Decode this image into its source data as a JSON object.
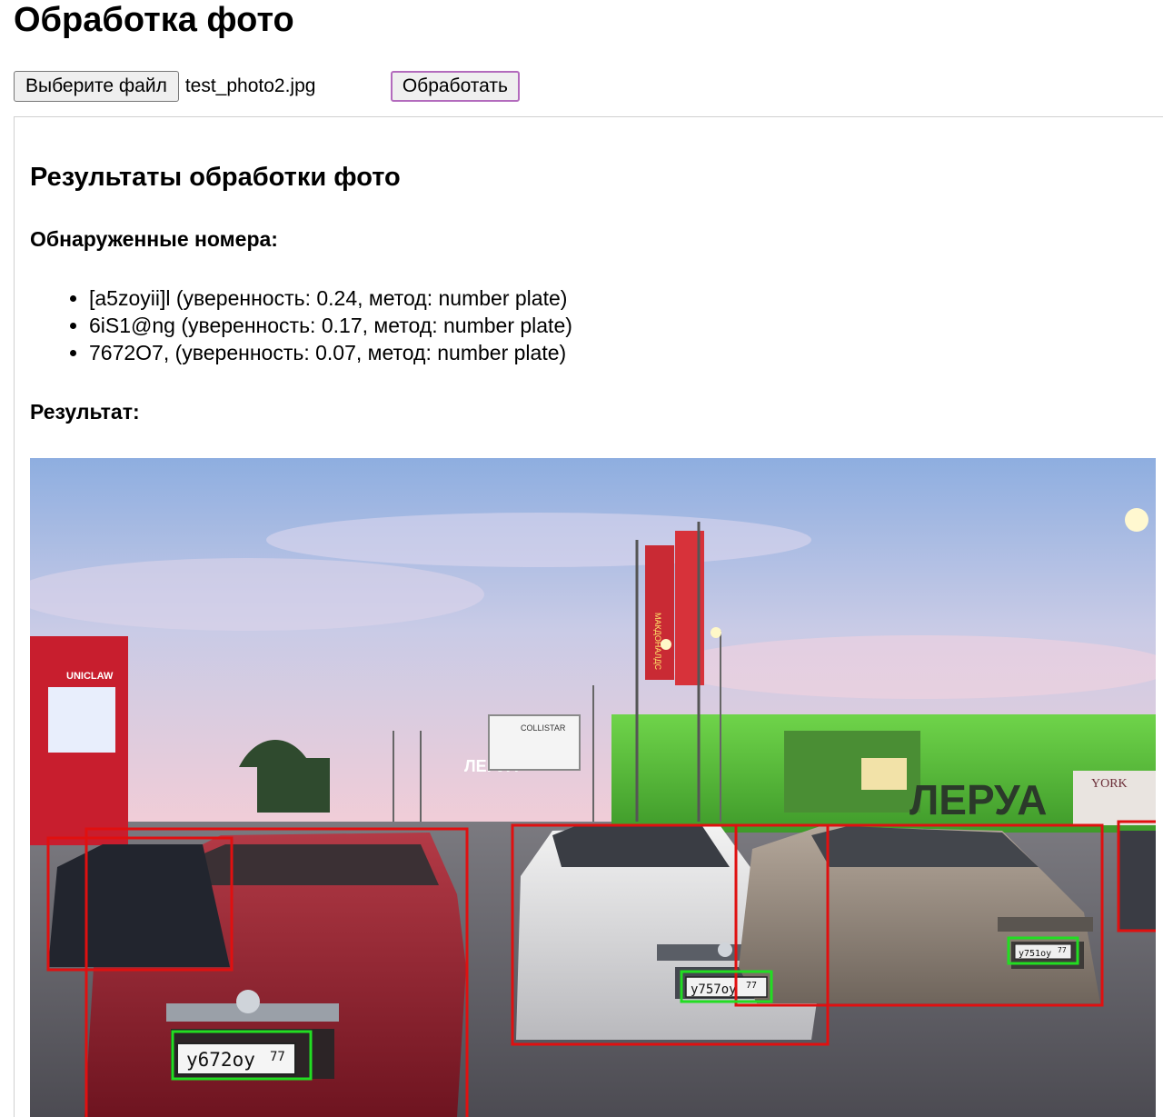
{
  "page": {
    "title": "Обработка фото"
  },
  "upload": {
    "choose_label": "Выберите файл",
    "file_name": "test_photo2.jpg",
    "process_label": "Обработать"
  },
  "results": {
    "title": "Результаты обработки фото",
    "plates_heading": "Обнаруженные номера:",
    "plates": [
      {
        "text": "[a5zoyii]l (уверенность: 0.24, метод: number plate)"
      },
      {
        "text": "6iS1@ng (уверенность: 0.17, метод: number plate)"
      },
      {
        "text": "7672O7, (уверенность: 0.07, метод: number plate)"
      }
    ],
    "result_heading": "Результат:"
  },
  "photo": {
    "store_sign": "ЛЕРУА",
    "store_sign_small": "ЛЕРУА",
    "brand_sign": "YORK",
    "billboard_text": "COLLISTAR",
    "banner_text": "МАКДОНАЛДС",
    "bank_sign": "UNICLAW",
    "plate_front_red": "у672оу",
    "plate_front_red_region": "77",
    "plate_white_car": "у757оу",
    "plate_white_car_region": "77",
    "plate_grey_car": "у751оу",
    "plate_grey_car_region": "77",
    "detection_vehicle_color": "#e01010",
    "detection_plate_color": "#22dd22",
    "sky_top": "#8eaee0",
    "sky_bottom": "#f4cdd6"
  }
}
